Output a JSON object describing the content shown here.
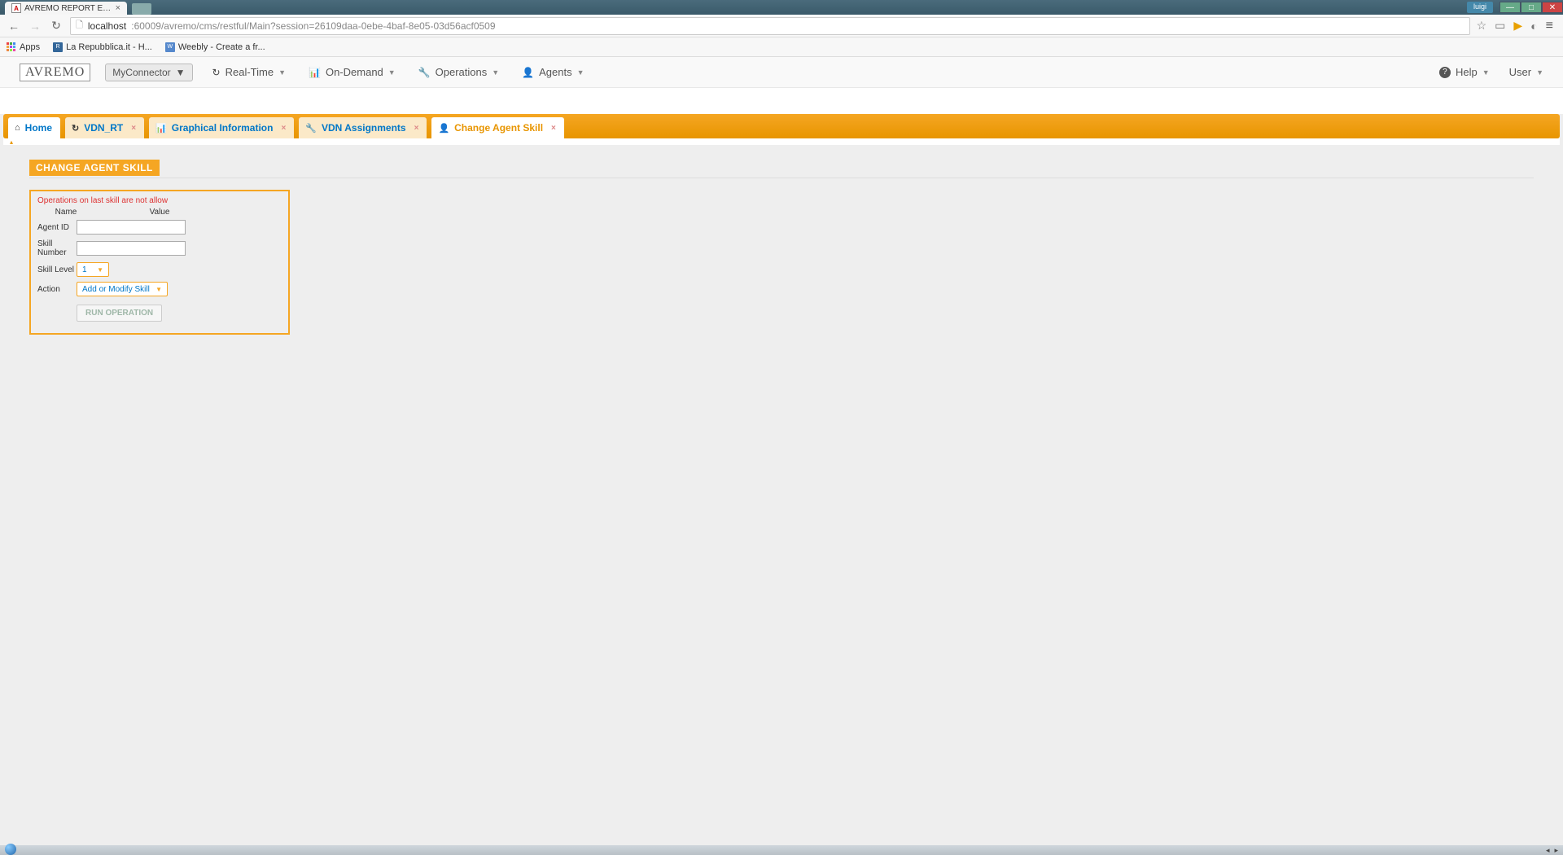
{
  "browser": {
    "tab_title": "AVREMO REPORT EXPLORER",
    "url_host": "localhost",
    "url_rest": ":60009/avremo/cms/restful/Main?session=26109daa-0ebe-4baf-8e05-03d56acf0509",
    "user_badge": "luigi"
  },
  "bookmarks": {
    "apps": "Apps",
    "items": [
      {
        "label": "La Repubblica.it - H..."
      },
      {
        "label": "Weebly - Create a fr..."
      }
    ]
  },
  "nav": {
    "logo": "AVREMO",
    "connector": "MyConnector",
    "items": [
      {
        "label": "Real-Time",
        "icon": "↻"
      },
      {
        "label": "On-Demand",
        "icon": "📊"
      },
      {
        "label": "Operations",
        "icon": "🔧"
      },
      {
        "label": "Agents",
        "icon": "👤"
      }
    ],
    "right": [
      {
        "label": "Help",
        "icon": "?"
      },
      {
        "label": "User",
        "icon": ""
      }
    ]
  },
  "tabs": [
    {
      "label": "Home",
      "icon": "⌂",
      "closable": false,
      "active": true
    },
    {
      "label": "VDN_RT",
      "icon": "↻",
      "closable": true,
      "active": false
    },
    {
      "label": "Graphical Information",
      "icon": "📊",
      "closable": true,
      "active": false
    },
    {
      "label": "VDN Assignments",
      "icon": "🔧",
      "closable": true,
      "active": false
    },
    {
      "label": "Change Agent Skill",
      "icon": "👤",
      "closable": true,
      "active": false,
      "bold": true
    }
  ],
  "page": {
    "title": "CHANGE AGENT SKILL",
    "warning": "Operations on last skill are not allow",
    "header_name": "Name",
    "header_value": "Value",
    "rows": {
      "agent_id_label": "Agent ID",
      "agent_id_value": "",
      "skill_number_label": "Skill Number",
      "skill_number_value": "",
      "skill_level_label": "Skill Level",
      "skill_level_value": "1",
      "action_label": "Action",
      "action_value": "Add or Modify Skill"
    },
    "run_button": "RUN OPERATION"
  }
}
